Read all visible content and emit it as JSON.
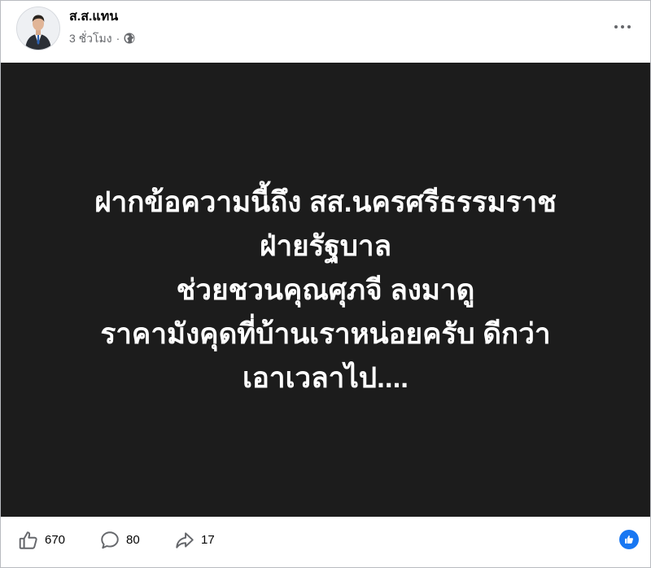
{
  "post": {
    "author": "ส.ส.แทน",
    "time": "3 ชั่วโมง",
    "separator": "·",
    "privacy_icon": "globe-icon",
    "more_icon": "more-options-icon",
    "image_text_lines": [
      "ฝากข้อความนี้ถึง สส.นครศรีธรรมราช",
      "ฝ่ายรัฐบาล",
      "ช่วยชวนคุณศุภจี ลงมาดู",
      "ราคามังคุดที่บ้านเราหน่อยครับ ดีกว่า",
      "เอาเวลาไป...."
    ],
    "image_background": "#1c1c1c"
  },
  "footer": {
    "likes": "670",
    "comments": "80",
    "shares": "17",
    "like_icon": "thumbs-up-icon",
    "comment_icon": "comment-icon",
    "share_icon": "share-icon",
    "reaction_badge_icon": "like-reaction-icon",
    "accent_color": "#1877f2"
  }
}
